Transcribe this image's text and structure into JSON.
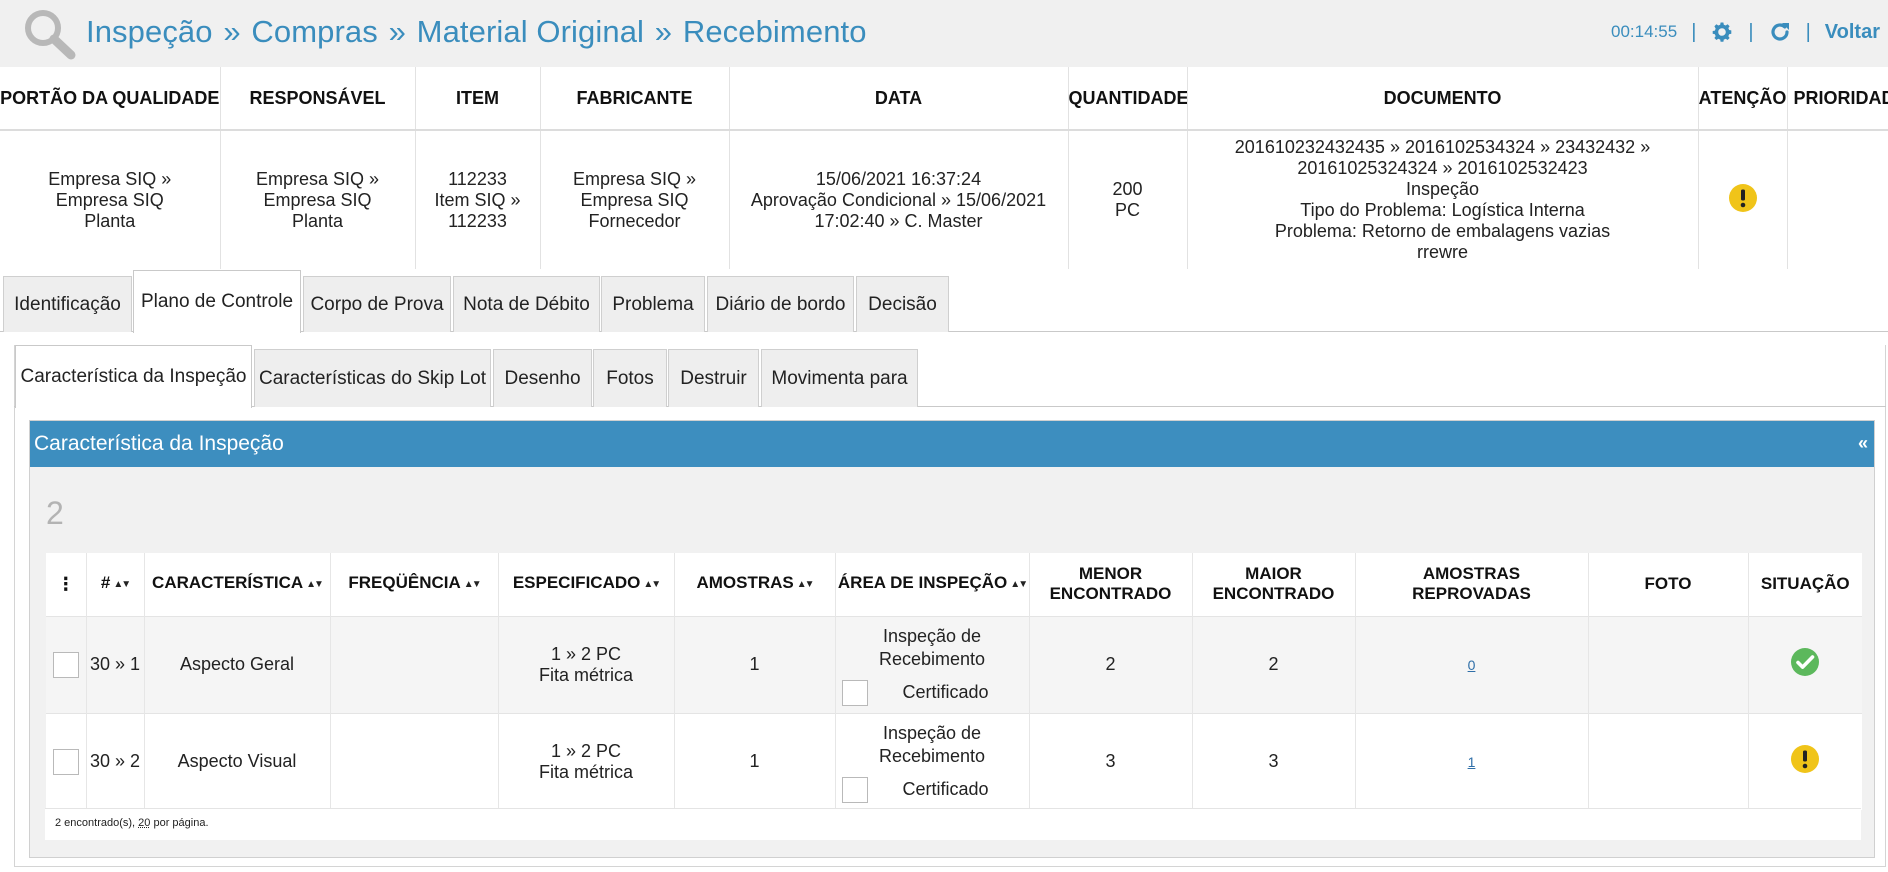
{
  "header": {
    "breadcrumb": [
      "Inspeção",
      "Compras",
      "Material Original",
      "Recebimento"
    ],
    "breadcrumb_sep": "»",
    "timer": "00:14:55",
    "separator": "|",
    "back_label": "Voltar"
  },
  "info": {
    "columns": [
      "PORTÃO DA QUALIDADE",
      "RESPONSÁVEL",
      "ITEM",
      "FABRICANTE",
      "DATA",
      "QUANTIDADE",
      "DOCUMENTO",
      "ATENÇÃO",
      "PRIORIDADE"
    ],
    "portao": [
      "Empresa SIQ » Empresa SIQ",
      "Planta"
    ],
    "responsavel": [
      "Empresa SIQ »",
      "Empresa SIQ",
      "Planta"
    ],
    "item": [
      "112233",
      "Item SIQ »",
      "112233"
    ],
    "fabricante": [
      "Empresa SIQ »",
      "Empresa SIQ",
      "Fornecedor"
    ],
    "data": [
      "15/06/2021 16:37:24",
      "Aprovação Condicional » 15/06/2021",
      "17:02:40 » C. Master"
    ],
    "quantidade": [
      "200",
      "PC"
    ],
    "documento": [
      "201610232432435 » 2016102534324 » 23432432 »",
      "20161025324324 » 2016102532423",
      "Inspeção",
      "Tipo do Problema: Logística Interna",
      "Problema: Retorno de embalagens vazias",
      "rrewre"
    ],
    "atencao_icon": "exclamation-circle-icon"
  },
  "tabs": [
    "Identificação",
    "Plano de Controle",
    "Corpo de Prova",
    "Nota de Débito",
    "Problema",
    "Diário de bordo",
    "Decisão"
  ],
  "tabs_active": "Plano de Controle",
  "subtabs": [
    "Característica da Inspeção",
    "Características do Skip Lot",
    "Desenho",
    "Fotos",
    "Destruir",
    "Movimenta para"
  ],
  "subtabs_active": "Característica da Inspeção",
  "panel": {
    "title": "Característica da Inspeção",
    "collapse": "«",
    "count": "2"
  },
  "grid": {
    "columns": [
      "⋮",
      "#",
      "CARACTERÍSTICA",
      "FREQÜÊNCIA",
      "ESPECIFICADO",
      "AMOSTRAS",
      "ÁREA DE INSPEÇÃO",
      "MENOR ENCONTRADO",
      "MAIOR ENCONTRADO",
      "AMOSTRAS REPROVADAS",
      "FOTO",
      "SITUAÇÃO"
    ],
    "rows": [
      {
        "num": "30 » 1",
        "caracteristica": "Aspecto Geral",
        "frequencia": "",
        "especificado": [
          "1 » 2 PC",
          "Fita métrica"
        ],
        "amostras": "1",
        "area": [
          "Inspeção de",
          "Recebimento"
        ],
        "area_check": "Certificado",
        "menor": "2",
        "maior": "2",
        "reprovadas": "0",
        "foto": "",
        "situacao": "check-circle-icon",
        "situacao_color": "#5cb85c"
      },
      {
        "num": "30 » 2",
        "caracteristica": "Aspecto Visual",
        "frequencia": "",
        "especificado": [
          "1 » 2 PC",
          "Fita métrica"
        ],
        "amostras": "1",
        "area": [
          "Inspeção de",
          "Recebimento"
        ],
        "area_check": "Certificado",
        "menor": "3",
        "maior": "3",
        "reprovadas": "1",
        "foto": "",
        "situacao": "exclamation-circle-icon",
        "situacao_color": "#f0c419"
      }
    ],
    "footer_prefix": "2 encontrado(s), ",
    "footer_per_page": "20",
    "footer_suffix": " por página."
  },
  "colors": {
    "accent": "#3a8dbd",
    "panel_header": "#3d8ebf",
    "warning": "#f0c419",
    "success": "#5cb85c"
  }
}
